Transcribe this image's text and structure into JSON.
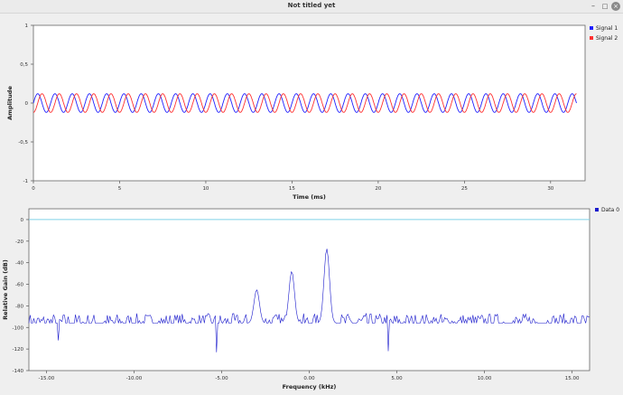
{
  "window": {
    "title": "Not titled yet",
    "buttons": {
      "minimize": "–",
      "maximize": "□",
      "close": "×"
    }
  },
  "time_plot": {
    "chart_data": {
      "type": "line",
      "xlabel": "Time (ms)",
      "ylabel": "Amplitude",
      "xlim": [
        0,
        32
      ],
      "ylim": [
        -1,
        1
      ],
      "x_ticks": [
        "0",
        "5",
        "10",
        "15",
        "20",
        "25",
        "30"
      ],
      "y_ticks": [
        "1",
        "0,5",
        "0",
        "-0,5",
        "-1"
      ],
      "grid": false,
      "legend_position": "top-right",
      "series": [
        {
          "name": "Signal 1",
          "color": "#2020ff",
          "shape": "sine",
          "amplitude": 0.12,
          "period_ms": 1.0,
          "phase_ms": 0.0,
          "x_range": [
            0,
            31.5
          ]
        },
        {
          "name": "Signal 2",
          "color": "#ff3030",
          "shape": "sine",
          "amplitude": 0.12,
          "period_ms": 1.0,
          "phase_ms": 0.25,
          "x_range": [
            0,
            31.5
          ]
        }
      ]
    }
  },
  "freq_plot": {
    "chart_data": {
      "type": "line",
      "xlabel": "Frequency (kHz)",
      "ylabel": "Relative Gain (dB)",
      "xlim": [
        -16,
        16
      ],
      "ylim": [
        -140,
        10
      ],
      "x_ticks": [
        "-15.00",
        "-10.00",
        "-5.00",
        "0.00",
        "5.00",
        "10.00",
        "15.00"
      ],
      "y_ticks": [
        "0",
        "-20",
        "-40",
        "-60",
        "-80",
        "-100",
        "-120",
        "-140"
      ],
      "grid": false,
      "legend_position": "top-right",
      "reference_line": {
        "y": 0,
        "color": "#7fd0e8"
      },
      "series": [
        {
          "name": "Data 0",
          "color": "#1a1acc",
          "noise_floor_db": -96,
          "noise_range_db": [
            -106,
            -88
          ],
          "peaks": [
            {
              "x": -3.0,
              "y": -65
            },
            {
              "x": -1.0,
              "y": -48
            },
            {
              "x": 1.0,
              "y": -27
            }
          ],
          "dips": [
            {
              "x": -5.3,
              "y": -123
            },
            {
              "x": 4.5,
              "y": -122
            },
            {
              "x": -14.3,
              "y": -112
            }
          ]
        }
      ]
    }
  }
}
